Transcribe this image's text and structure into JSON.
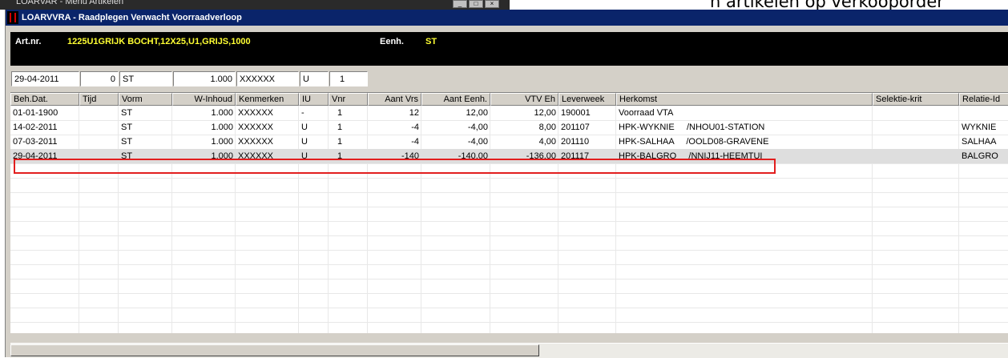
{
  "background": {
    "window_title": "LOARVAR - Menu Artikelen",
    "right_text": "n artikelen op verkooporder"
  },
  "window": {
    "title": "LOARVVRA - Raadplegen Verwacht Voorraadverloop"
  },
  "info": {
    "art_label": "Art.nr.",
    "art_value": "1225U1GRIJK  BOCHT,12X25,U1,GRIJS,1000",
    "eenh_label": "Eenh.",
    "eenh_value": "ST"
  },
  "filters": [
    "29-04-2011",
    "0",
    "ST",
    "1.000",
    "XXXXXX",
    "U",
    "1"
  ],
  "columns": [
    "Beh.Dat.",
    "Tijd",
    "Vorm",
    "W-Inhoud",
    "Kenmerken",
    "IU",
    "Vnr",
    "Aant Vrs",
    "Aant Eenh.",
    "VTV Eh",
    "Leverweek",
    "Herkomst",
    "Selektie-krit",
    "Relatie-Id"
  ],
  "rows": [
    {
      "beh_dat": "01-01-1900",
      "tijd": "",
      "vorm": "ST",
      "w_inhoud": "1.000",
      "kenmerken": "XXXXXX",
      "iu": "-",
      "vnr": "1",
      "aant_vrs": "12",
      "aant_eenh": "12,00",
      "vtv_eh": "12,00",
      "leverweek": "190001",
      "herkomst": "Voorraad VTA",
      "selektie": "",
      "relatie": ""
    },
    {
      "beh_dat": "14-02-2011",
      "tijd": "",
      "vorm": "ST",
      "w_inhoud": "1.000",
      "kenmerken": "XXXXXX",
      "iu": "U",
      "vnr": "1",
      "aant_vrs": "-4",
      "aant_eenh": "-4,00",
      "vtv_eh": "8,00",
      "leverweek": "201107",
      "herkomst": "HPK-WYKNIE     /NHOU01-STATION",
      "selektie": "",
      "relatie": "WYKNIE"
    },
    {
      "beh_dat": "07-03-2011",
      "tijd": "",
      "vorm": "ST",
      "w_inhoud": "1.000",
      "kenmerken": "XXXXXX",
      "iu": "U",
      "vnr": "1",
      "aant_vrs": "-4",
      "aant_eenh": "-4,00",
      "vtv_eh": "4,00",
      "leverweek": "201110",
      "herkomst": "HPK-SALHAA     /OOLD08-GRAVENE",
      "selektie": "",
      "relatie": "SALHAA"
    },
    {
      "beh_dat": "29-04-2011",
      "tijd": "",
      "vorm": "ST",
      "w_inhoud": "1.000",
      "kenmerken": "XXXXXX",
      "iu": "U",
      "vnr": "1",
      "aant_vrs": "-140",
      "aant_eenh": "-140,00",
      "vtv_eh": "-136,00",
      "leverweek": "201117",
      "herkomst": "HPK-BALGRO     /NNIJ11-HEEMTUI",
      "selektie": "",
      "relatie": "BALGRO"
    }
  ],
  "selected_row": 3,
  "colors": {
    "title_bar": "#0a246a",
    "info_bg": "#000000",
    "info_value": "#ffff33",
    "highlight": "#e21e1e"
  }
}
